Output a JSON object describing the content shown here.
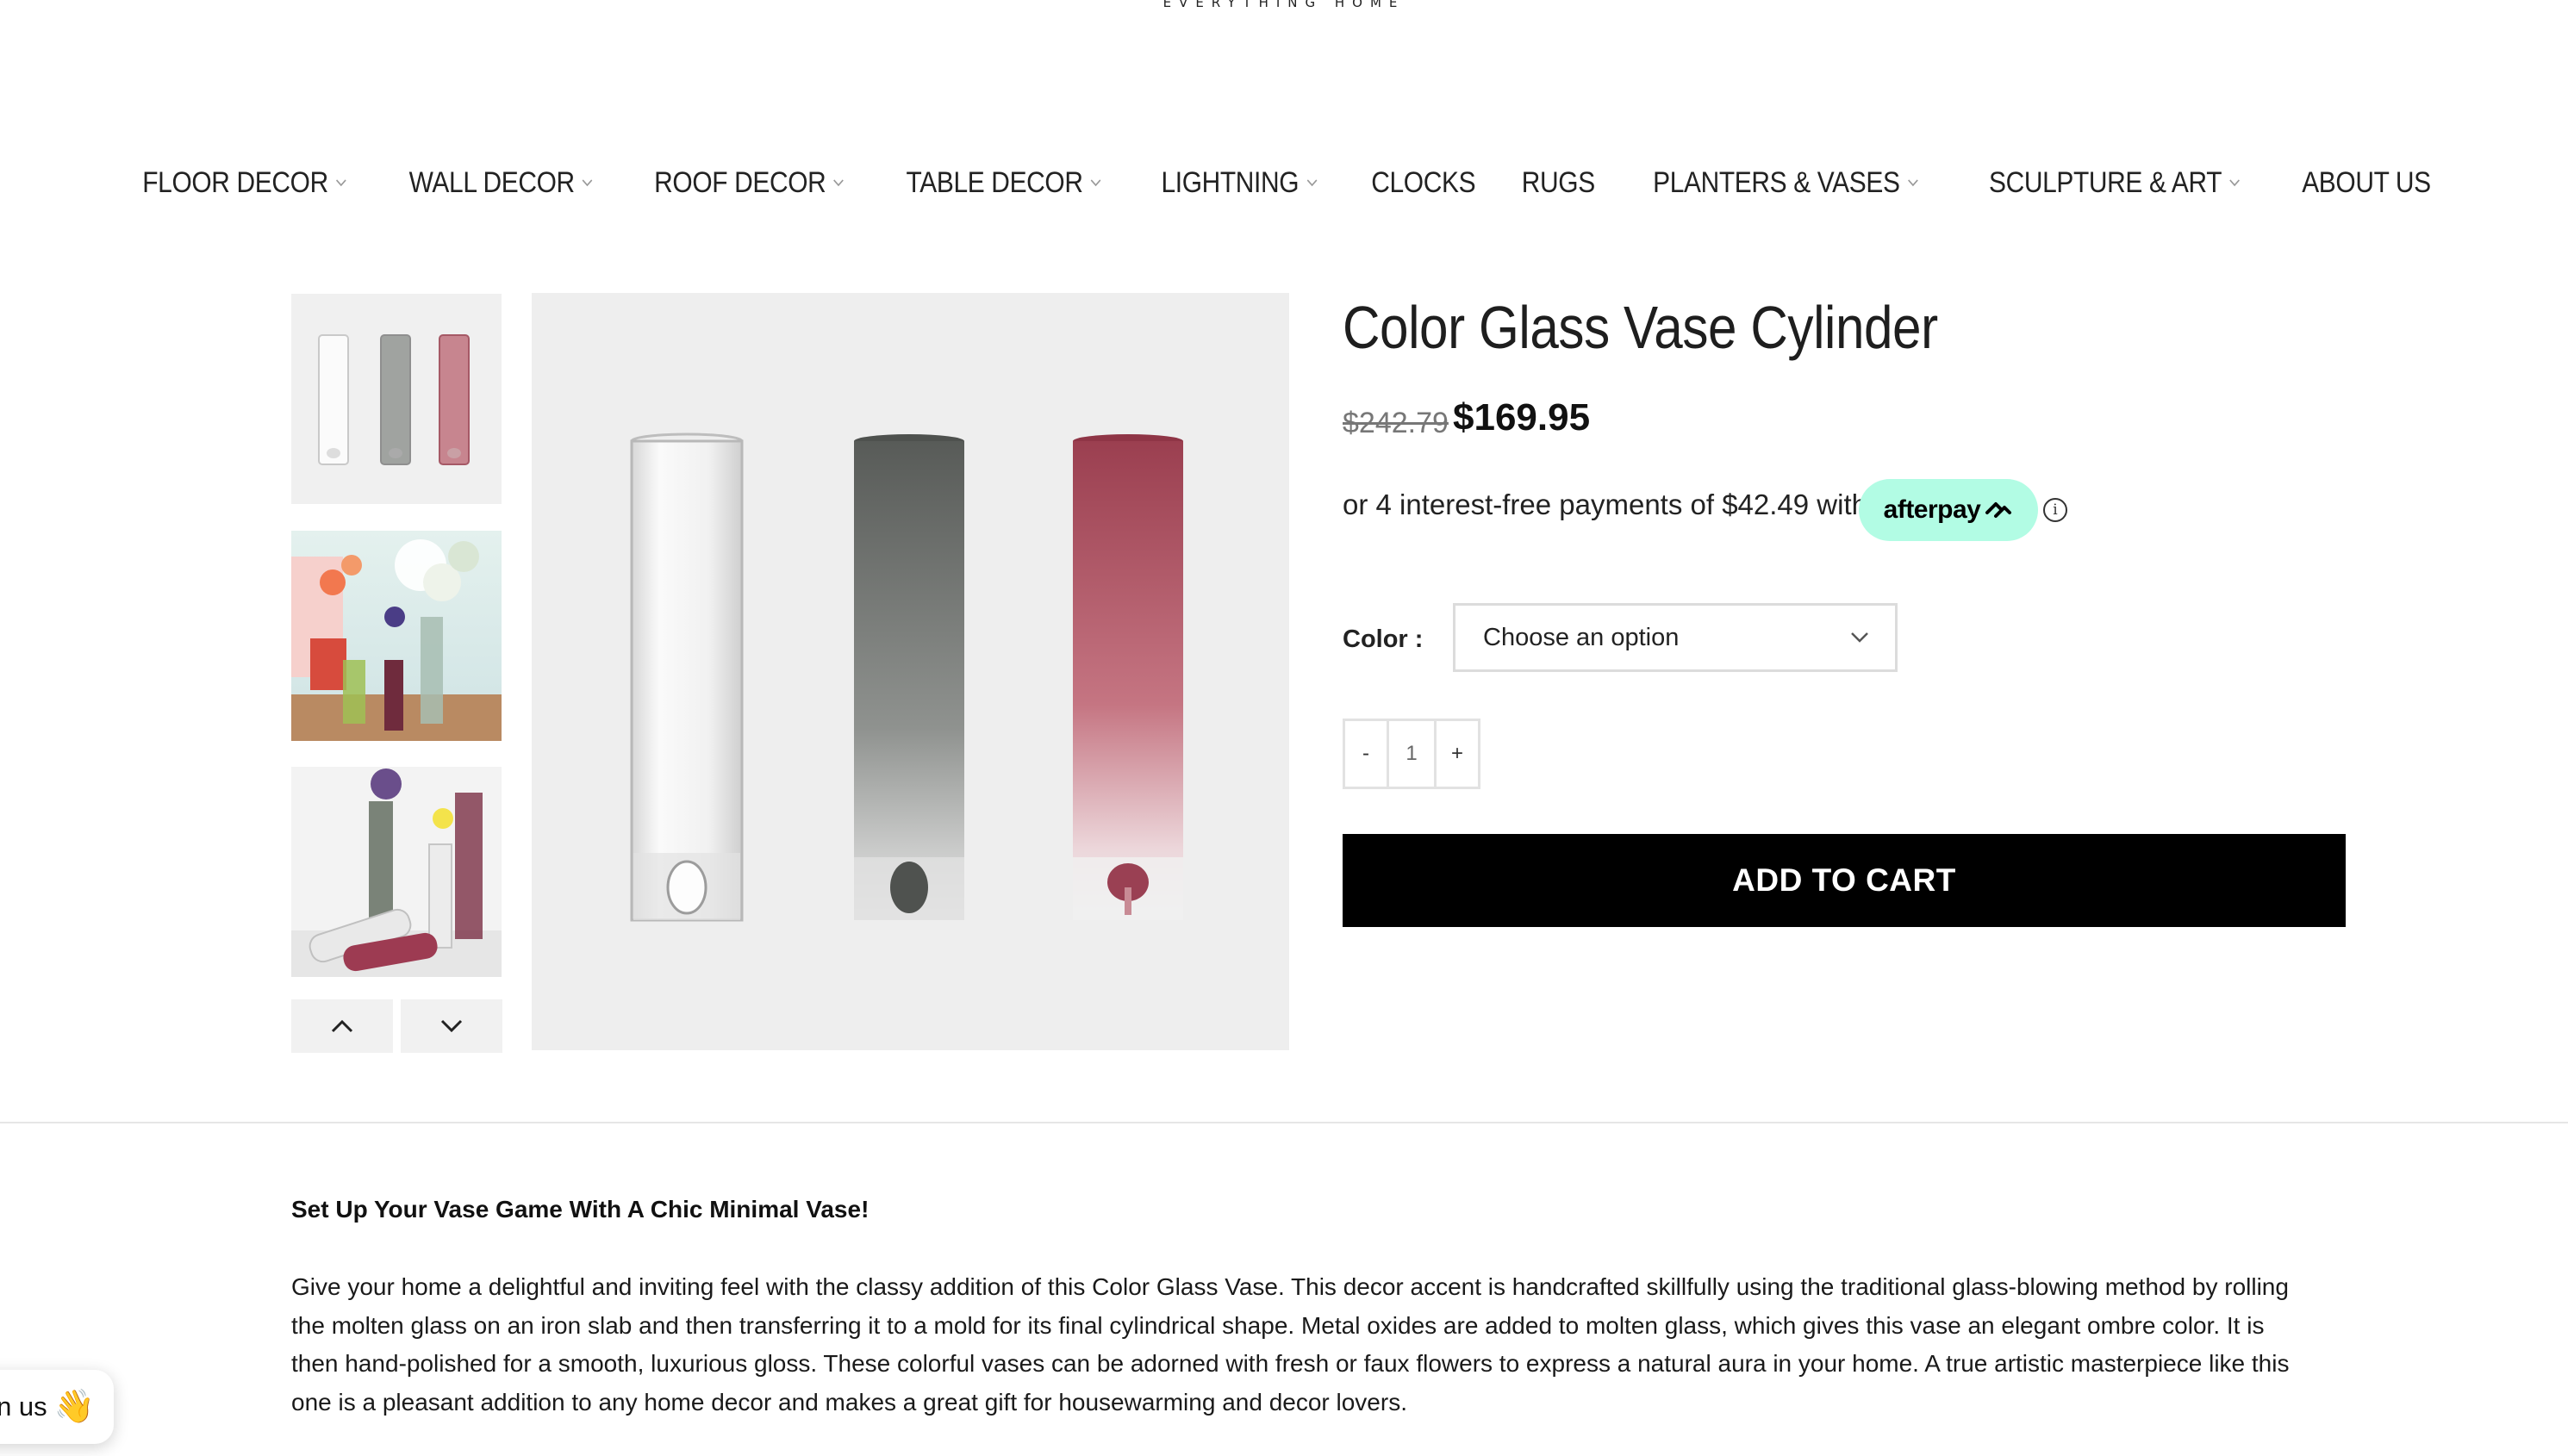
{
  "logo": {
    "tagline": "EVERYTHING HOME"
  },
  "nav": {
    "items": [
      {
        "label": "FLOOR DECOR",
        "dropdown": true
      },
      {
        "label": "WALL DECOR",
        "dropdown": true
      },
      {
        "label": "ROOF DECOR",
        "dropdown": true
      },
      {
        "label": "TABLE DECOR",
        "dropdown": true
      },
      {
        "label": "LIGHTNING",
        "dropdown": true
      },
      {
        "label": "CLOCKS",
        "dropdown": false
      },
      {
        "label": "RUGS",
        "dropdown": false
      },
      {
        "label": "PLANTERS & VASES",
        "dropdown": true
      },
      {
        "label": "SCULPTURE & ART",
        "dropdown": true
      },
      {
        "label": "ABOUT US",
        "dropdown": false
      }
    ]
  },
  "product": {
    "title": "Color Glass Vase Cylinder",
    "price_old": "$242.79",
    "price_new": "$169.95",
    "afterpay_text": "or 4 interest-free payments of $42.49 with",
    "afterpay_brand": "afterpay",
    "info_icon": "ⓘ",
    "color_label": "Color :",
    "color_select_value": "Choose an option",
    "qty_minus": "-",
    "qty_value": "1",
    "qty_plus": "+",
    "add_to_cart": "ADD TO CART",
    "vase_colors": [
      "#f4f4f4",
      "#5e615e",
      "#a5505e"
    ]
  },
  "description": {
    "heading": "Set Up Your Vase Game With A Chic Minimal Vase!",
    "body": "Give your home a delightful and inviting feel with the classy addition of this Color Glass Vase. This decor accent is handcrafted skillfully using the traditional glass-blowing method by rolling the molten glass on an iron slab and then transferring it to a mold for its final cylindrical shape. Metal oxides are added to molten glass, which gives this vase an elegant ombre color. It is then hand-polished for a smooth, luxurious gloss. These colorful vases can be adorned with fresh or faux flowers to express a natural aura in your home. A true artistic masterpiece like this one is a pleasant addition to any home decor and makes a great gift for housewarming and decor lovers."
  },
  "chat": {
    "label": "n us",
    "emoji": "👋"
  }
}
